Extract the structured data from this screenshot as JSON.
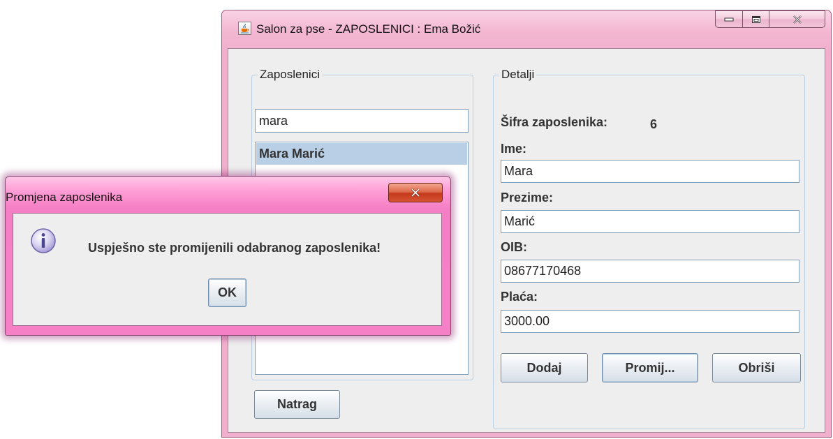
{
  "main_window": {
    "title": "Salon za pse - ZAPOSLENICI : Ema Božić",
    "icon": "java-cup-icon"
  },
  "employees_panel": {
    "title": "Zaposlenici",
    "search_value": "mara",
    "items": [
      "Mara Marić"
    ],
    "selected_index": 0
  },
  "details_panel": {
    "title": "Detalji",
    "id_label": "Šifra zaposlenika:",
    "id_value": "6",
    "first_name_label": "Ime:",
    "first_name_value": "Mara",
    "last_name_label": "Prezime:",
    "last_name_value": "Marić",
    "oib_label": "OIB:",
    "oib_value": "08677170468",
    "salary_label": "Plaća:",
    "salary_value": "3000.00"
  },
  "buttons": {
    "add": "Dodaj",
    "change": "Promij...",
    "delete": "Obriši",
    "back": "Natrag"
  },
  "dialog": {
    "title": "Promjena zaposlenika",
    "message": "Uspješno ste promijenili odabranog zaposlenika!",
    "ok": "OK",
    "icon": "info-icon"
  },
  "colors": {
    "main_frame": "#f0b0cd",
    "dialog_frame": "#f580c6",
    "selection": "#b8cfe5",
    "panel_background": "#eeeeee",
    "close_button": "#c53a1c"
  }
}
